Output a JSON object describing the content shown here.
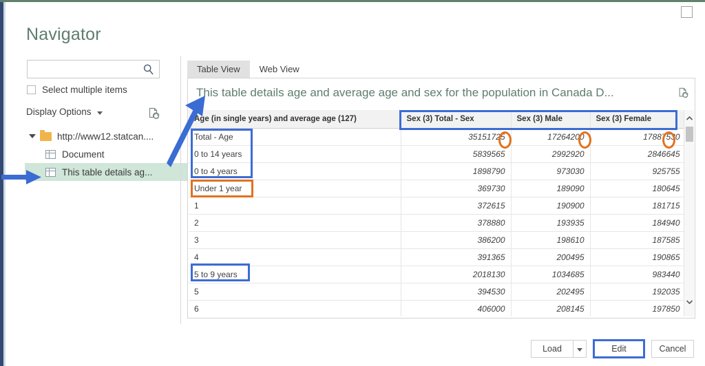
{
  "window": {
    "title": "Navigator",
    "titlebar_button": "restore-box"
  },
  "sidebar": {
    "search": {
      "value": "",
      "placeholder": "",
      "icon": "search-icon"
    },
    "select_multiple_label": "Select multiple items",
    "display_options_label": "Display Options",
    "refresh_icon": "refresh-page-icon",
    "tree": [
      {
        "label": "http://www12.statcan....",
        "icon": "folder-icon",
        "level": 0,
        "expanded": true,
        "selected": false
      },
      {
        "label": "Document",
        "icon": "table-icon",
        "level": 1,
        "selected": false
      },
      {
        "label": "This table details ag...",
        "icon": "table-icon",
        "level": 1,
        "selected": true
      }
    ]
  },
  "preview": {
    "tabs": [
      {
        "label": "Table View",
        "active": true
      },
      {
        "label": "Web View",
        "active": false
      }
    ],
    "title": "This table details age and average age and sex for the population in Canada D...",
    "title_icon": "refresh-page-icon",
    "columns": [
      "Age (in single years) and average age (127)",
      "Sex (3) Total - Sex",
      "Sex (3) Male",
      "Sex (3) Female"
    ],
    "rows": [
      {
        "label": "Total - Age",
        "total": "35151725",
        "male": "17264200",
        "female": "17887530"
      },
      {
        "label": "0 to 14 years",
        "total": "5839565",
        "male": "2992920",
        "female": "2846645"
      },
      {
        "label": "0 to 4 years",
        "total": "1898790",
        "male": "973030",
        "female": "925755"
      },
      {
        "label": "Under 1 year",
        "total": "369730",
        "male": "189090",
        "female": "180645"
      },
      {
        "label": "1",
        "total": "372615",
        "male": "190900",
        "female": "181715"
      },
      {
        "label": "2",
        "total": "378880",
        "male": "193935",
        "female": "184940"
      },
      {
        "label": "3",
        "total": "386200",
        "male": "198610",
        "female": "187585"
      },
      {
        "label": "4",
        "total": "391365",
        "male": "200495",
        "female": "190865"
      },
      {
        "label": "5 to 9 years",
        "total": "2018130",
        "male": "1034685",
        "female": "983440"
      },
      {
        "label": "5",
        "total": "394530",
        "male": "202495",
        "female": "192035"
      },
      {
        "label": "6",
        "total": "406000",
        "male": "208145",
        "female": "197850"
      }
    ],
    "scrollbar": {
      "up_icon": "chevron-up-icon",
      "down_icon": "chevron-down-icon"
    }
  },
  "footer": {
    "load_label": "Load",
    "load_dropdown_icon": "chevron-down-icon",
    "edit_label": "Edit",
    "cancel_label": "Cancel"
  },
  "annotations": {
    "accent_blue": "#3b6cd4",
    "accent_orange": "#e2711d",
    "highlight_green": "#cfe6d8"
  }
}
